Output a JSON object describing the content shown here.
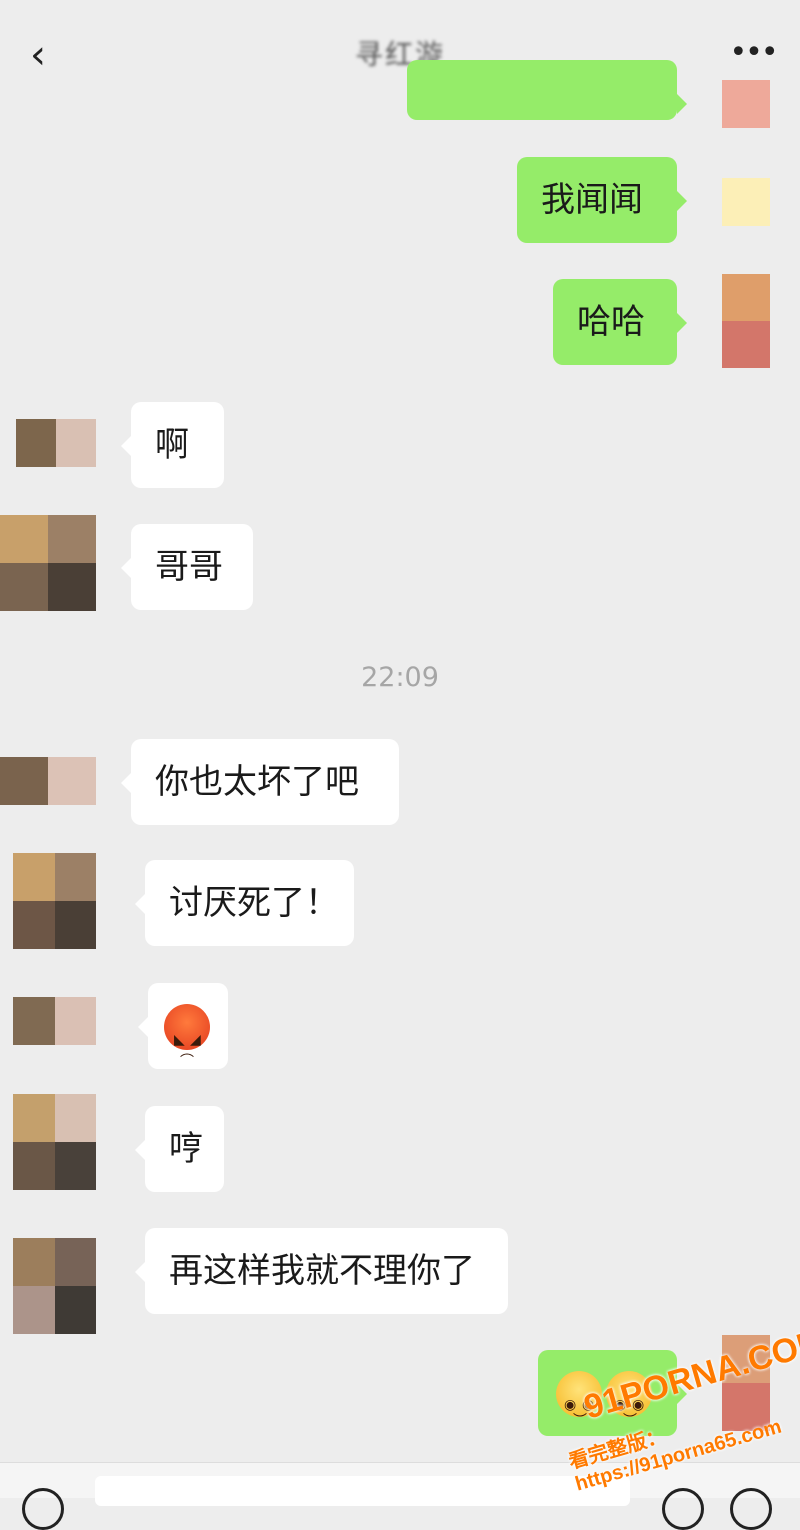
{
  "header": {
    "back_icon": "chevron-left-icon",
    "title": "寻红漩",
    "more_icon": "ellipsis-icon"
  },
  "messages": [
    {
      "side": "right",
      "text": ""
    },
    {
      "side": "right",
      "text": "我闻闻"
    },
    {
      "side": "right",
      "text": "哈哈"
    },
    {
      "side": "left",
      "text": "啊"
    },
    {
      "side": "left",
      "text": "哥哥"
    },
    {
      "side": "left",
      "text": "你也太坏了吧"
    },
    {
      "side": "left",
      "text": "讨厌死了！"
    },
    {
      "side": "left",
      "emoji": "angry-face"
    },
    {
      "side": "left",
      "text": "哼"
    },
    {
      "side": "left",
      "text": "再这样我就不理你了"
    },
    {
      "side": "right",
      "emoji": "pleading-face-x2"
    }
  ],
  "timestamp": "22:09",
  "watermark": {
    "line1": "91PORNA.COM",
    "line2": "看完整版：https://91porna65.com"
  },
  "colors": {
    "background": "#ededed",
    "sent_bubble": "#95ec69",
    "received_bubble": "#ffffff",
    "timestamp": "#a6a6a6"
  }
}
